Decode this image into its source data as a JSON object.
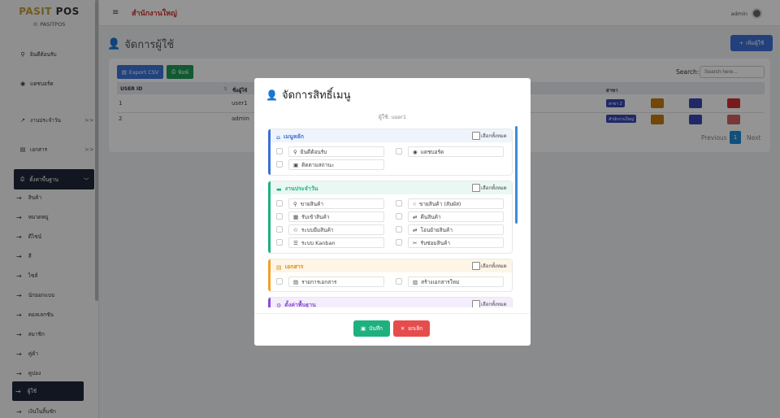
{
  "sidebar": {
    "brand_a": "PASIT",
    "brand_b": " POS",
    "brand_sub": "© PASITPOS",
    "items": [
      {
        "label": "ยินดีต้อนรับ",
        "icon": "sitemap-icon"
      },
      {
        "label": "แดชบอร์ด",
        "icon": "dashboard-icon"
      },
      {
        "label": "งานประจำวัน",
        "icon": "trend-icon"
      },
      {
        "label": "เอกสาร",
        "icon": "file-icon"
      }
    ],
    "active_group": "ตั้งค่าพื้นฐาน",
    "sub_items": [
      "สินค้า",
      "หมวดหมู่",
      "ดีไซน์",
      "สี",
      "ไซส์",
      "นักออกแบบ",
      "คอลเลกชัน",
      "สมาชิก",
      "คู่ค้า",
      "คูปอง",
      "ผู้ใช้",
      "เงินในลิ้นชัก"
    ],
    "selected_sub": "ผู้ใช้"
  },
  "topbar": {
    "branch": "สำนักงานใหญ่",
    "username": "admin"
  },
  "page": {
    "title": "จัดการผู้ใช้",
    "add_user": "เพิ่มผู้ใช้",
    "export_csv": "Export CSV",
    "print": "พิมพ์",
    "search_label": "Search:",
    "search_placeholder": "Search here...",
    "table": {
      "col_userid": "USER ID",
      "col_user": "ชื่อผู้ใช้",
      "col_branch": "สาขา",
      "rows": [
        {
          "id": "1",
          "user": "user1",
          "branch": "สาขา 2"
        },
        {
          "id": "2",
          "user": "admin",
          "branch": "สำนักงานใหญ่"
        }
      ]
    },
    "pagination": {
      "prev": "Previous",
      "current": "1",
      "next": "Next"
    }
  },
  "modal": {
    "title": "จัดการสิทธิ์เมนู",
    "user_line": "ผู้ใช้: user1",
    "select_all": "เลือกทั้งหมด",
    "sections": [
      {
        "title": "เมนูหลัก",
        "icon": "home-icon",
        "color": "#3b6fd4",
        "items": [
          "ยินดีต้อนรับ",
          "แดชบอร์ด",
          "ติดตามสถานะ"
        ]
      },
      {
        "title": "งานประจำวัน",
        "icon": "briefcase-icon",
        "color": "#1fb07f",
        "items": [
          "ขายสินค้า",
          "ขายสินค้า (สัมผัส)",
          "รับเข้าสินค้า",
          "คืนสินค้า",
          "ระบบยืมสินค้า",
          "โอนย้ายสินค้า",
          "ระบบ Kanban",
          "รับซ่อมสินค้า"
        ]
      },
      {
        "title": "เอกสาร",
        "icon": "document-icon",
        "color": "#f0a028",
        "items": [
          "รายการเอกสาร",
          "สร้างเอกสารใหม่"
        ]
      },
      {
        "title": "ตั้งค่าพื้นฐาน",
        "icon": "settings-icon",
        "color": "#8a4bd6",
        "items": []
      }
    ],
    "save": "บันทึก",
    "cancel": "ยกเลิก"
  },
  "colors": {
    "accent_blue": "#3b6fd4",
    "success": "#1fb07f",
    "danger": "#e74c4c",
    "warning": "#f0a028",
    "purple": "#8a4bd6",
    "sidebar_dark": "#1f2737"
  }
}
